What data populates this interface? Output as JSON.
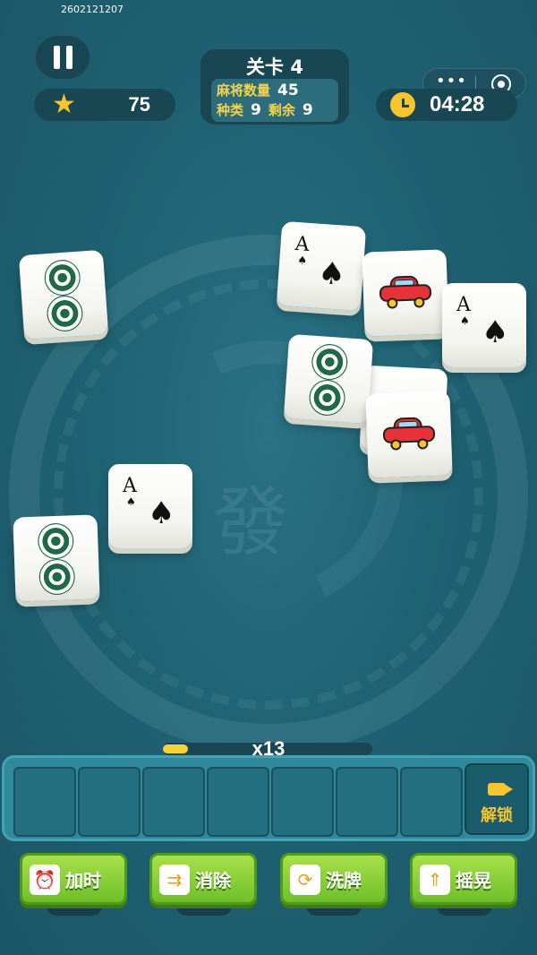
{
  "session_id": "2602121207",
  "header": {
    "stars": "75",
    "level_title": "关卡 4",
    "tile_count_label": "麻将数量",
    "tile_count_value": "45",
    "kinds_label": "种类",
    "kinds_value": "9",
    "remaining_label": "剩余",
    "remaining_value": "9",
    "timer": "04:28",
    "menu_dots": "•••"
  },
  "board": {
    "background_char": "發",
    "tiles": [
      {
        "face": "two-circles"
      },
      {
        "face": "ace-spades"
      },
      {
        "face": "car"
      },
      {
        "face": "ace-spades"
      },
      {
        "face": "two-circles"
      },
      {
        "face": "blank"
      },
      {
        "face": "car"
      },
      {
        "face": "ace-spades"
      },
      {
        "face": "two-circles"
      }
    ],
    "ace_rank": "A",
    "spade_glyph": "♠"
  },
  "tray": {
    "combo": "x13",
    "combo_progress": 0.12,
    "slots": 7,
    "unlock_label": "解锁"
  },
  "powerups": [
    {
      "label": "加时",
      "icon": "alarm-clock-icon",
      "icon_glyph": "⏰"
    },
    {
      "label": "消除",
      "icon": "clear-arrows-icon",
      "icon_glyph": "⇉"
    },
    {
      "label": "洗牌",
      "icon": "shuffle-icon",
      "icon_glyph": "⟳"
    },
    {
      "label": "摇晃",
      "icon": "shake-up-icon",
      "icon_glyph": "⇑"
    }
  ],
  "colors": {
    "background": "#1f5e6e",
    "accent_yellow": "#f7c530",
    "button_green": "#6fbf2a",
    "tile_circle": "#1f6a45",
    "car_red": "#e8323a"
  }
}
